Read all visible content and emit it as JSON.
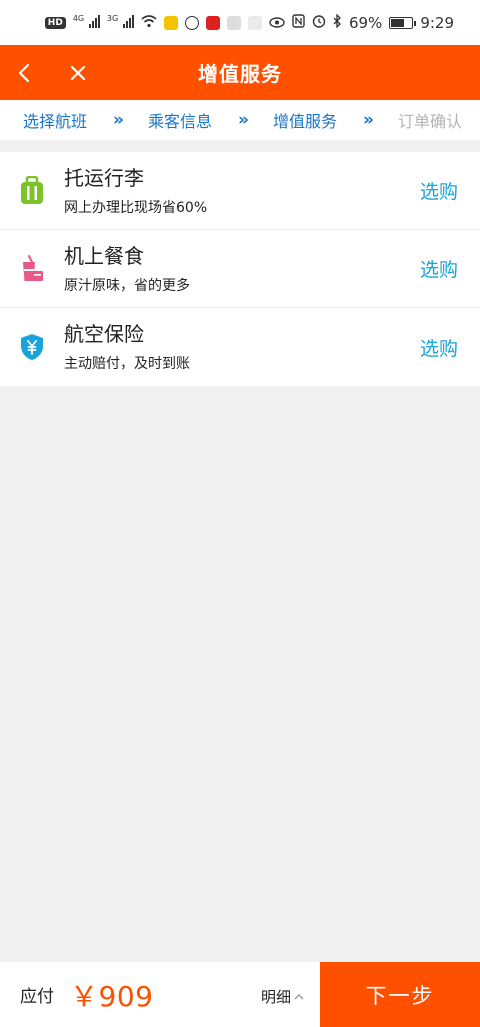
{
  "status_bar": {
    "hd": "HD",
    "net1": "4G",
    "net2": "3G",
    "battery_percent_text": "69%",
    "battery_level": 0.69,
    "time": "9:29"
  },
  "header": {
    "title": "增值服务",
    "back_icon": "chevron-left-icon",
    "close_icon": "close-icon",
    "color": "#ff5000"
  },
  "steps": [
    {
      "label": "选择航班",
      "active": true
    },
    {
      "label": "乘客信息",
      "active": true
    },
    {
      "label": "增值服务",
      "active": true
    },
    {
      "label": "订单确认",
      "active": false
    }
  ],
  "services": [
    {
      "title": "托运行李",
      "desc": "网上办理比现场省60%",
      "action": "选购",
      "icon": "luggage-icon",
      "icon_color": "#7cc22a"
    },
    {
      "title": "机上餐食",
      "desc": "原汁原味，省的更多",
      "action": "选购",
      "icon": "meal-icon",
      "icon_color": "#e8588a"
    },
    {
      "title": "航空保险",
      "desc": "主动赔付，及时到账",
      "action": "选购",
      "icon": "shield-yen-icon",
      "icon_color": "#1aa3d8"
    }
  ],
  "footer": {
    "pay_label": "应付",
    "amount": "￥909",
    "detail_label": "明细",
    "next_label": "下一步"
  }
}
